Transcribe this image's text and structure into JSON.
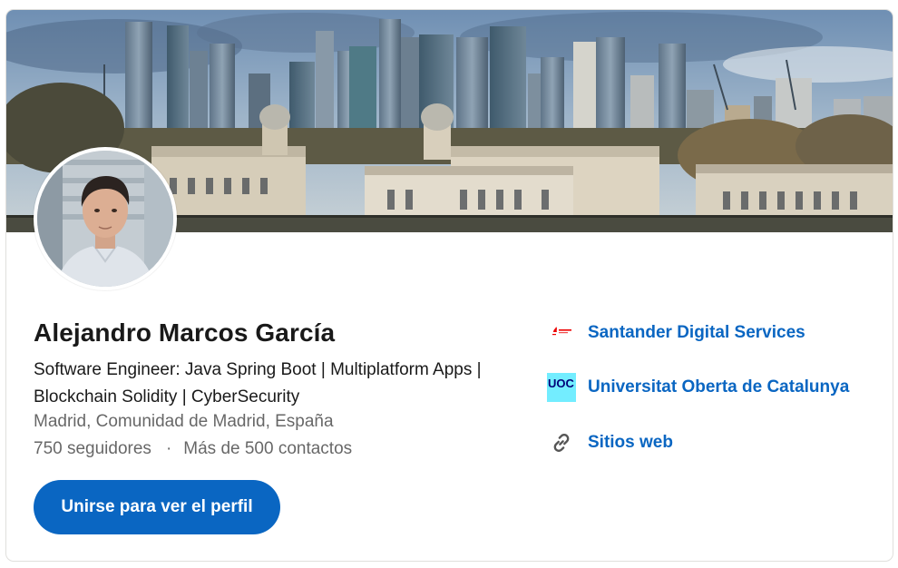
{
  "profile": {
    "name": "Alejandro Marcos García",
    "headline": "Software Engineer: Java Spring Boot | Multiplatform Apps | Blockchain Solidity | CyberSecurity",
    "location": "Madrid, Comunidad de Madrid, España",
    "followers": "750 seguidores",
    "separator": "·",
    "connections": "Más de 500 contactos"
  },
  "actions": {
    "join_label": "Unirse para ver el perfil"
  },
  "sidebar": {
    "items": [
      {
        "label": "Santander Digital Services",
        "icon": "santander-logo-icon"
      },
      {
        "label": "Universitat Oberta de Catalunya",
        "icon": "uoc-logo-icon",
        "logo_text": "UOC"
      },
      {
        "label": "Sitios web",
        "icon": "link-icon"
      }
    ]
  },
  "colors": {
    "accent": "#0a66c2",
    "uoc_brand": "#73edff",
    "santander_red": "#ec0000"
  }
}
